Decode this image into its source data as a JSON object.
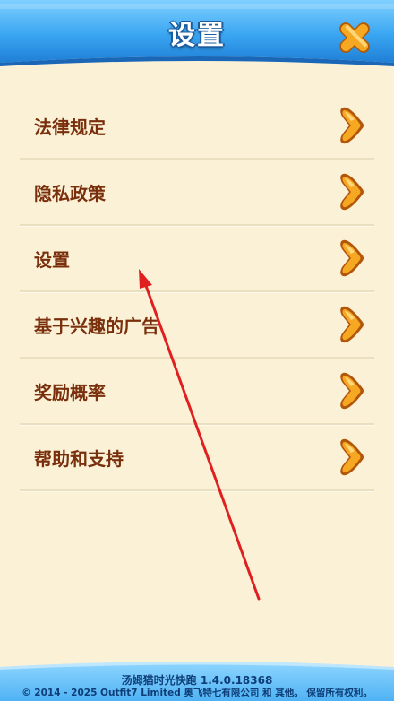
{
  "header": {
    "title": "设置",
    "close_icon": "close-x-icon",
    "accent_color": "#2c8ce0",
    "close_color": "#f6a21e"
  },
  "menu": {
    "items": [
      {
        "label": "法律规定",
        "icon": "chevron-right-icon"
      },
      {
        "label": "隐私政策",
        "icon": "chevron-right-icon"
      },
      {
        "label": "设置",
        "icon": "chevron-right-icon"
      },
      {
        "label": "基于兴趣的广告",
        "icon": "chevron-right-icon"
      },
      {
        "label": "奖励概率",
        "icon": "chevron-right-icon"
      },
      {
        "label": "帮助和支持",
        "icon": "chevron-right-icon"
      }
    ],
    "text_color": "#7a2f0c",
    "chevron_color": "#f6a21e"
  },
  "footer": {
    "version": "汤姆猫时光快跑 1.4.0.18368",
    "copyright_prefix": "© 2014 - 2025 Outfit7 Limited 奥飞特七有限公司 和 ",
    "others_link": "其他",
    "copyright_suffix": "。 保留所有权利。"
  },
  "annotation": {
    "color": "#e02020"
  }
}
